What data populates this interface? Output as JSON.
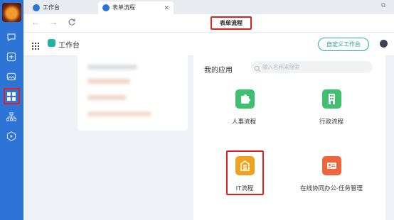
{
  "tabs": [
    {
      "label": "工作台"
    },
    {
      "label": "表单流程"
    }
  ],
  "window": {
    "page_title": "表单流程"
  },
  "header": {
    "title": "工作台",
    "custom_button": "自定义工作台"
  },
  "my_apps": {
    "title": "我的应用",
    "search_placeholder": "输入名称来搜索",
    "apps": [
      {
        "label": "人事流程",
        "icon": "puzzle-icon",
        "color": "#3fbf6f"
      },
      {
        "label": "行政流程",
        "icon": "building-icon",
        "color": "#3fbf6f"
      },
      {
        "label": "IT流程",
        "icon": "server-icon",
        "color": "#f0a21e"
      },
      {
        "label": "在线协同办公-任务管理",
        "icon": "id-card-icon",
        "color": "#f0643b"
      }
    ]
  },
  "colors": {
    "rail": "#2d74d6",
    "accent": "#23b5a2",
    "highlight": "#e02020"
  }
}
